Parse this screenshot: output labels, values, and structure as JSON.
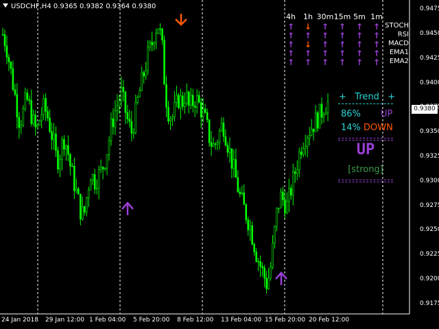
{
  "header": {
    "symbol_line": "USDCHF,H4  0.9365 0.9382 0.9364 0.9380"
  },
  "colors": {
    "candle": "#00ff00",
    "up": "#9a3fd6",
    "down": "#ff5a00",
    "cyan": "#2ad4d4",
    "grid": "#ffffff"
  },
  "timeframes": [
    "4h",
    "1h",
    "30m",
    "15m",
    "5m",
    "1m"
  ],
  "indicators": [
    {
      "name": "STOCH",
      "signals": [
        "up",
        "down",
        "up",
        "up",
        "up",
        "up"
      ]
    },
    {
      "name": "RSI",
      "signals": [
        "up",
        "up",
        "up",
        "up",
        "up",
        "up"
      ]
    },
    {
      "name": "MACD",
      "signals": [
        "up",
        "down",
        "up",
        "up",
        "up",
        "up"
      ]
    },
    {
      "name": "EMA1",
      "signals": [
        "up",
        "up",
        "up",
        "up",
        "up",
        "up"
      ]
    },
    {
      "name": "EMA2",
      "signals": [
        "up",
        "up",
        "up",
        "up",
        "up",
        "up"
      ]
    }
  ],
  "trend_panel": {
    "title": "+   Trend   +",
    "up_pct": "86%",
    "up_label": "UP",
    "down_pct": "14%",
    "down_label": "DOWN",
    "verdict": "UP",
    "strength": "[strong]"
  },
  "price_axis": {
    "labels": [
      "0.9475",
      "0.9450",
      "0.9425",
      "0.9400",
      "0.9375",
      "0.9350",
      "0.9325",
      "0.9300",
      "0.9275",
      "0.9250",
      "0.9225",
      "0.9200",
      "0.9175"
    ],
    "current": "0.9380"
  },
  "time_axis": {
    "labels": [
      "24 Jan 2018",
      "29 Jan 12:00",
      "1 Feb 04:00",
      "5 Feb 20:00",
      "8 Feb 12:00",
      "13 Feb 04:00",
      "15 Feb 20:00",
      "20 Feb 12:00"
    ]
  },
  "chart_data": {
    "type": "candlestick",
    "symbol": "USDCHF",
    "timeframe": "H4",
    "ylim": [
      0.9165,
      0.9485
    ],
    "close": [
      0.945,
      0.944,
      0.942,
      0.94,
      0.938,
      0.936,
      0.937,
      0.9385,
      0.9375,
      0.936,
      0.935,
      0.9365,
      0.9375,
      0.937,
      0.9355,
      0.934,
      0.932,
      0.933,
      0.9345,
      0.9335,
      0.9315,
      0.93,
      0.9285,
      0.927,
      0.9265,
      0.929,
      0.931,
      0.93,
      0.9305,
      0.931,
      0.932,
      0.9335,
      0.9355,
      0.937,
      0.938,
      0.939,
      0.9375,
      0.936,
      0.935,
      0.9365,
      0.9385,
      0.94,
      0.9415,
      0.943,
      0.944,
      0.9455,
      0.946,
      0.944,
      0.939,
      0.937,
      0.9365,
      0.9375,
      0.9385,
      0.938,
      0.939,
      0.9375,
      0.938,
      0.9385,
      0.9378,
      0.937,
      0.936,
      0.9345,
      0.9335,
      0.934,
      0.935,
      0.936,
      0.9345,
      0.933,
      0.9315,
      0.93,
      0.9285,
      0.9275,
      0.9265,
      0.9255,
      0.924,
      0.9225,
      0.9215,
      0.9205,
      0.9195,
      0.921,
      0.924,
      0.927,
      0.9285,
      0.928,
      0.9275,
      0.929,
      0.9305,
      0.932,
      0.9335,
      0.9345,
      0.935,
      0.9355,
      0.936,
      0.9365,
      0.937,
      0.9378,
      0.938
    ],
    "annotations": [
      {
        "label": "sell arrow",
        "direction": "down",
        "at_date": "8 Feb 12:00"
      },
      {
        "label": "buy arrow",
        "direction": "up",
        "at_date": "1 Feb 04:00"
      },
      {
        "label": "buy arrow",
        "direction": "up",
        "at_date": "15 Feb 20:00"
      }
    ]
  }
}
